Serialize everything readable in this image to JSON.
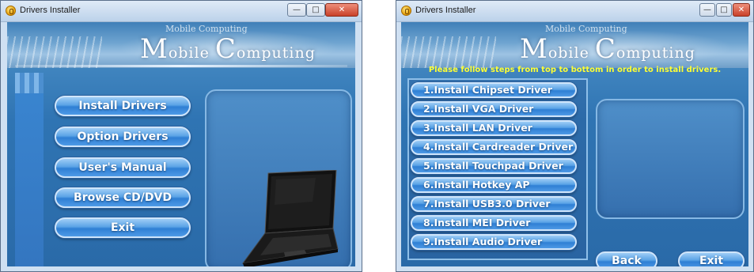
{
  "left_window": {
    "title": "Drivers Installer",
    "controls": {
      "minimize": "—",
      "maximize": "□",
      "close": "✕"
    },
    "brand": {
      "small": "Mobile Computing",
      "large_cap_1": "M",
      "large_rest_1": "obile ",
      "large_cap_2": "C",
      "large_rest_2": "omputing"
    },
    "menu": [
      "Install Drivers",
      "Option Drivers",
      "User's Manual",
      "Browse CD/DVD",
      "Exit"
    ]
  },
  "right_window": {
    "title": "Drivers Installer",
    "controls": {
      "minimize": "—",
      "maximize": "□",
      "close": "✕"
    },
    "brand": {
      "small": "Mobile Computing",
      "large_cap_1": "M",
      "large_rest_1": "obile ",
      "large_cap_2": "C",
      "large_rest_2": "omputing"
    },
    "instruction": "Please follow steps from top to bottom in order to install drivers.",
    "steps": [
      "1.Install Chipset Driver",
      "2.Install VGA Driver",
      "3.Install LAN Driver",
      "4.Install Cardreader Driver",
      "5.Install Touchpad Driver",
      "6.Install Hotkey AP",
      "7.Install USB3.0 Driver",
      "8.Install MEI Driver",
      "9.Install Audio Driver"
    ],
    "back_label": "Back",
    "exit_label": "Exit"
  }
}
